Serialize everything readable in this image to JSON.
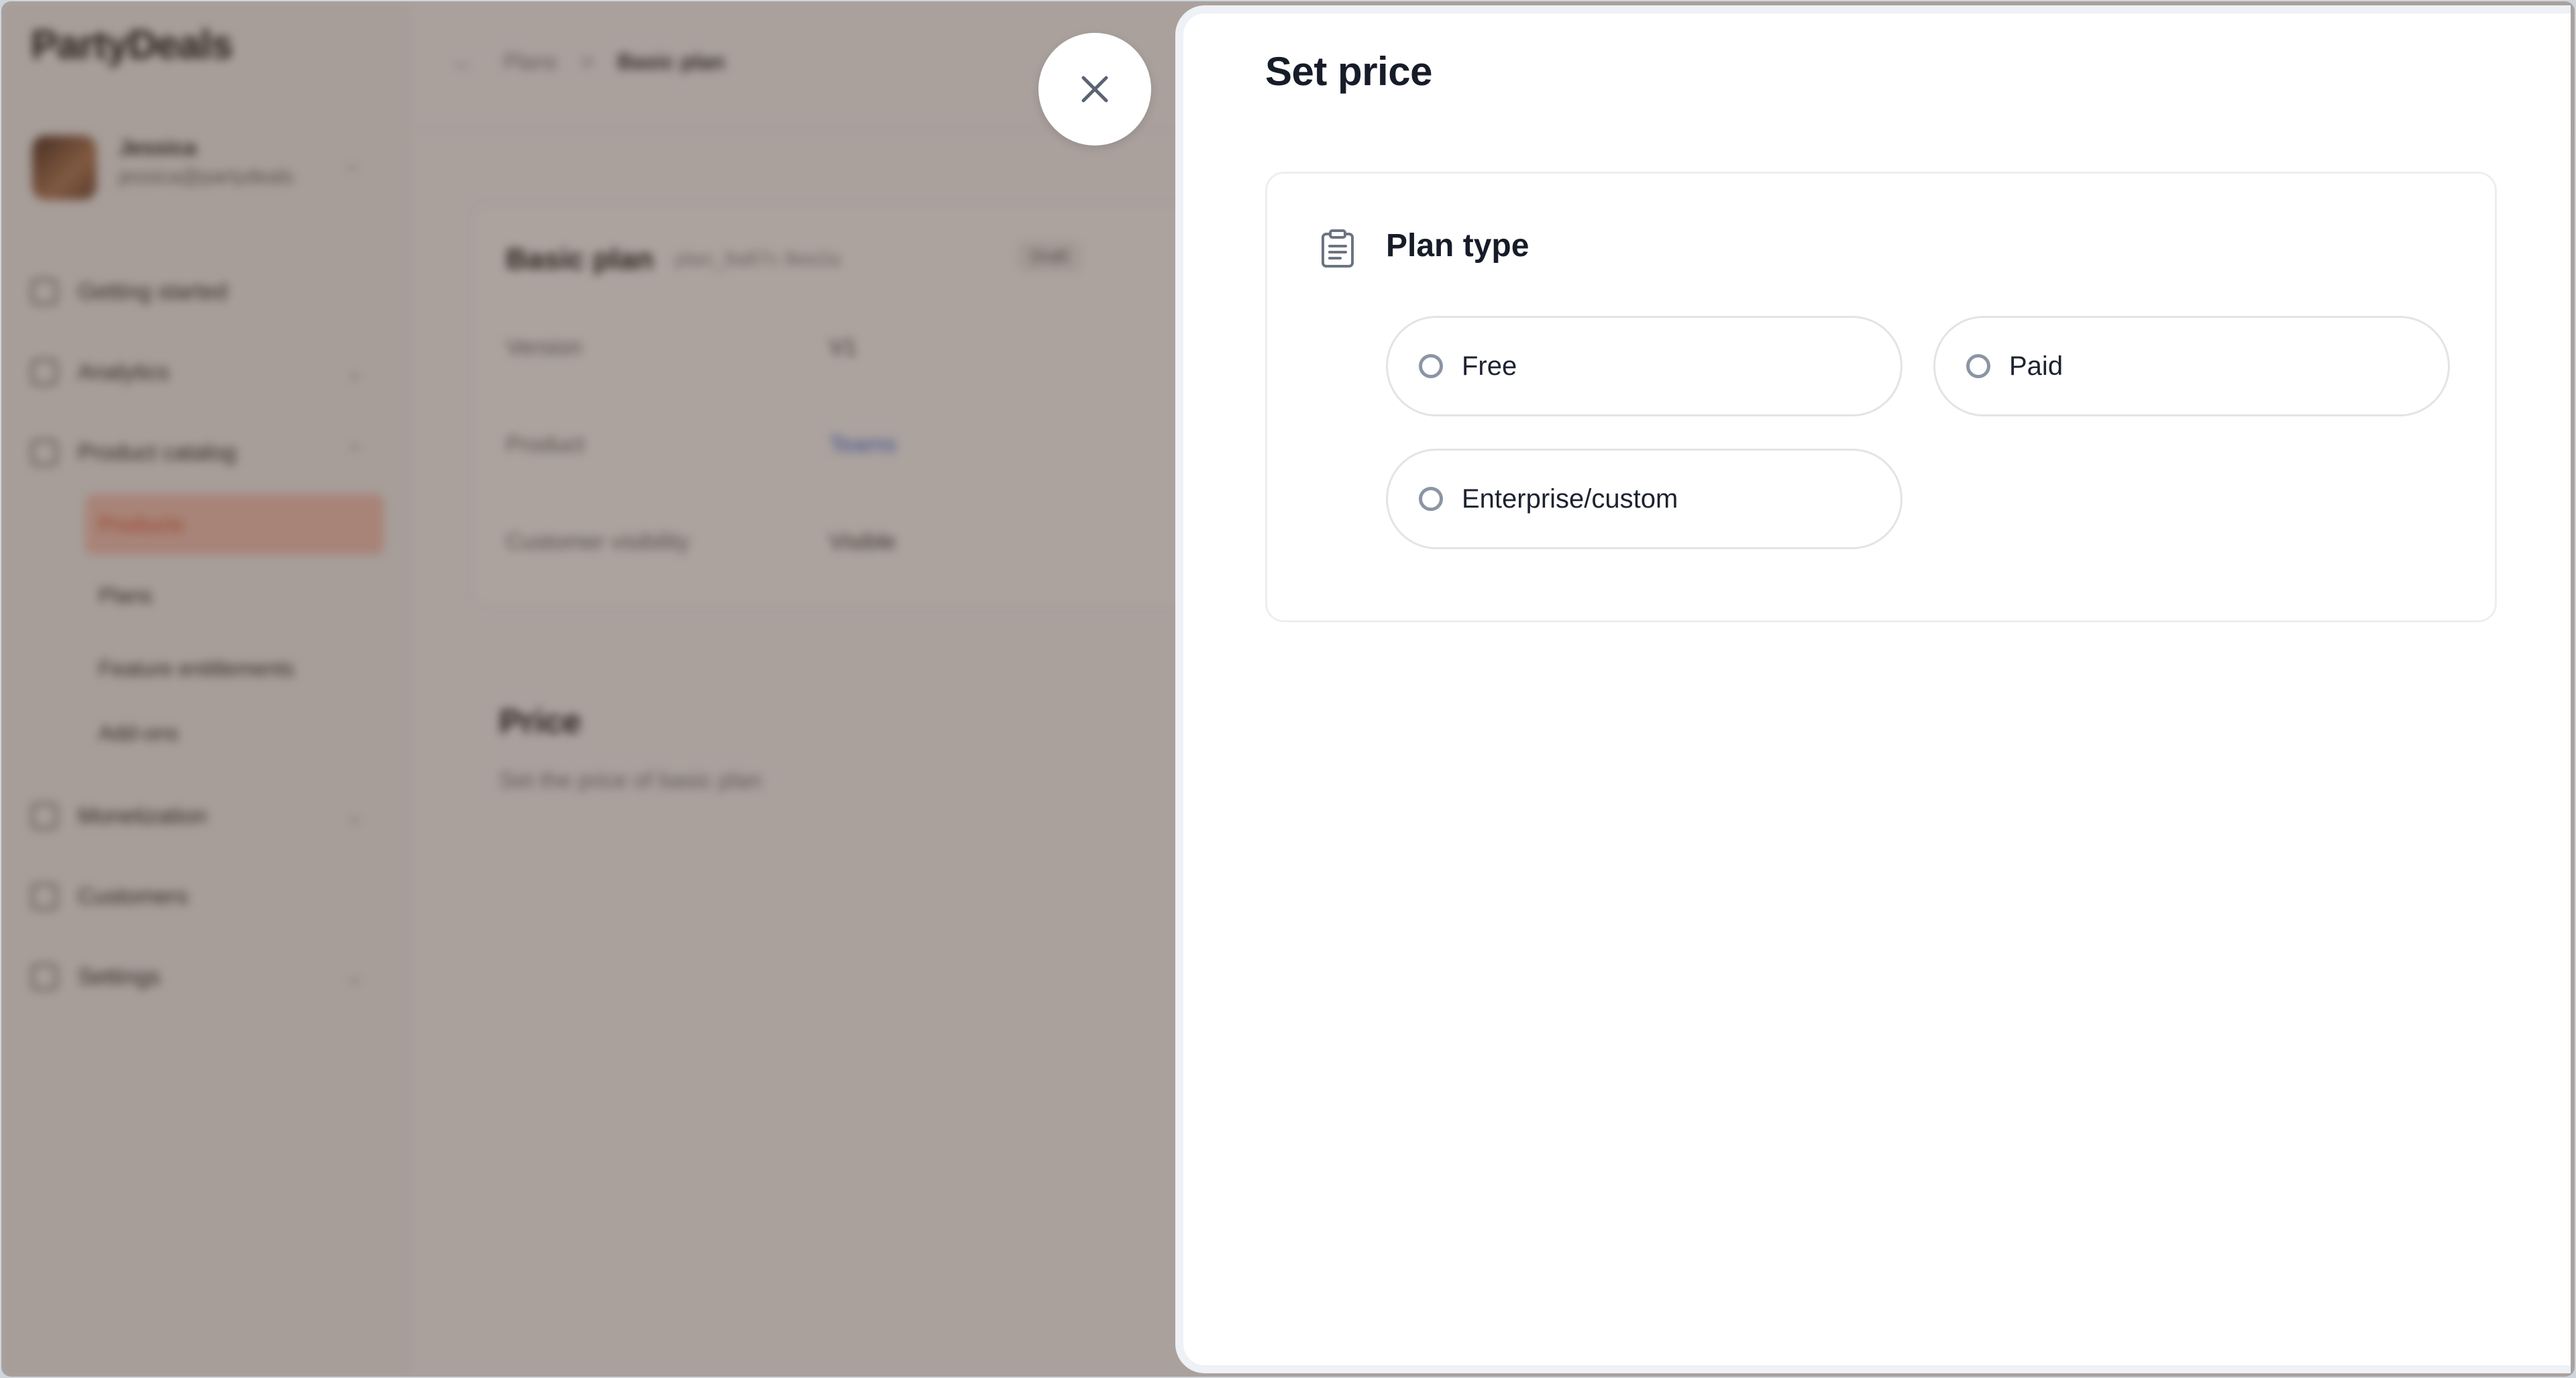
{
  "background": {
    "app_name": "PartyDeals",
    "profile": {
      "name": "Jessica",
      "email": "jessica@partydeals"
    },
    "nav": {
      "getting_started": "Getting started",
      "analytics": "Analytics",
      "product_catalog": "Product catalog",
      "products": "Products",
      "plans": "Plans",
      "feature_entitlements": "Feature entitlements",
      "add_ons": "Add-ons",
      "monetization": "Monetization",
      "customers": "Customers",
      "settings": "Settings"
    },
    "breadcrumb": {
      "parent": "Plans",
      "separator": ">",
      "current": "Basic plan"
    },
    "plan_card": {
      "title": "Basic plan",
      "meta": "plan_9a87c 8ee2a",
      "badge": "Draft",
      "rows": [
        {
          "label": "Version",
          "value": "V1"
        },
        {
          "label": "Product",
          "value": "Teams"
        },
        {
          "label": "Customer visibility",
          "value": "Visible"
        }
      ]
    },
    "price_section": {
      "title": "Price",
      "subtitle": "Set the price of basic plan"
    }
  },
  "drawer": {
    "title": "Set price",
    "plan_type": {
      "title": "Plan type",
      "icon": "clipboard-icon",
      "options": [
        {
          "label": "Free",
          "selected": false
        },
        {
          "label": "Paid",
          "selected": false
        },
        {
          "label": "Enterprise/custom",
          "selected": false
        }
      ]
    }
  },
  "close_button": {
    "icon": "close-icon"
  },
  "colors": {
    "overlay": "#48342a",
    "accent": "#e0532f",
    "radio_border": "#8b95a3",
    "text_primary": "#161c28"
  }
}
